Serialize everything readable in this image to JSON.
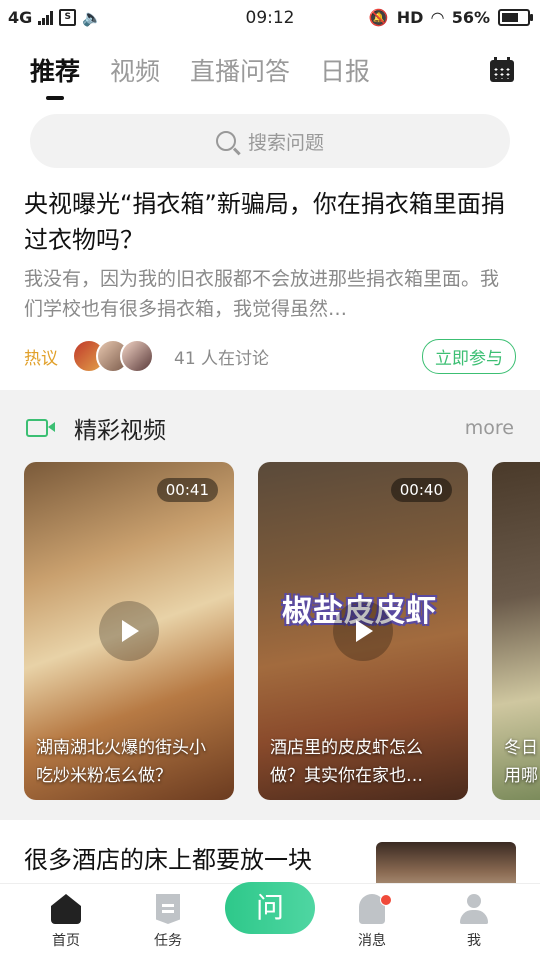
{
  "status": {
    "network": "4G",
    "time": "09:12",
    "hd": "HD",
    "battery": "56%"
  },
  "tabs": [
    {
      "label": "推荐",
      "active": true
    },
    {
      "label": "视频"
    },
    {
      "label": "直播问答"
    },
    {
      "label": "日报"
    }
  ],
  "search": {
    "placeholder": "搜索问题"
  },
  "question1": {
    "title": "央视曝光“捐衣箱”新骗局，你在捐衣箱里面捐过衣物吗？",
    "excerpt": "我没有，因为我的旧衣服都不会放进那些捐衣箱里面。我们学校也有很多捐衣箱，我觉得虽然…",
    "tag": "热议",
    "discuss": "41 人在讨论",
    "join": "立即参与"
  },
  "videos": {
    "title": "精彩视频",
    "more": "more",
    "items": [
      {
        "duration": "00:41",
        "caption": "湖南湖北火爆的街头小吃炒米粉怎么做？"
      },
      {
        "duration": "00:40",
        "overlay": "椒盐皮皮虾",
        "caption": "酒店里的皮皮虾怎么做？其实你在家也…"
      },
      {
        "caption": "冬日用哪"
      }
    ]
  },
  "question2": {
    "title": "很多酒店的床上都要放一块布，你知道为什么吗？"
  },
  "tabbar": {
    "home": "首页",
    "task": "任务",
    "ask": "问",
    "msg": "消息",
    "me": "我"
  },
  "colors": {
    "accent": "#3cbf73",
    "hot": "#e1a02a"
  }
}
